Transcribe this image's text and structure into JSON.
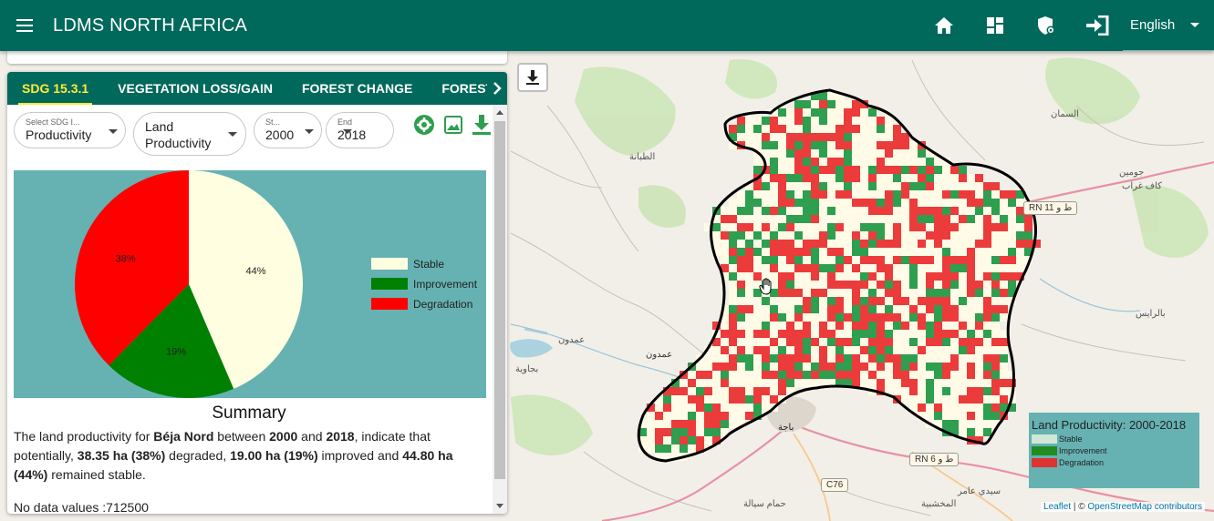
{
  "app": {
    "title": "LDMS NORTH AFRICA",
    "language": "English",
    "icons": [
      "menu-icon",
      "home-icon",
      "dashboard-icon",
      "security-icon",
      "login-icon"
    ]
  },
  "tabs": [
    {
      "label": "SDG 15.3.1",
      "active": true
    },
    {
      "label": "VEGETATION LOSS/GAIN",
      "active": false
    },
    {
      "label": "FOREST CHANGE",
      "active": false
    },
    {
      "label": "FOREST FIRE",
      "active": false
    }
  ],
  "controls": {
    "indicator": {
      "label": "Select SDG I...",
      "value": "Productivity"
    },
    "sub_indicator": {
      "value_line1": "Land",
      "value_line2": "Productivity"
    },
    "start": {
      "label": "St...",
      "value": "2000"
    },
    "end": {
      "label": "End",
      "value": "2018"
    }
  },
  "chart_data": {
    "type": "pie",
    "slices": [
      {
        "label": "Stable",
        "value": 44,
        "display": "44%",
        "color": "#fffee0"
      },
      {
        "label": "Improvement",
        "value": 19,
        "display": "19%",
        "color": "#008000"
      },
      {
        "label": "Degradation",
        "value": 38,
        "display": "38%",
        "color": "#ff0000"
      }
    ],
    "legend_position": "right"
  },
  "summary": {
    "title": "Summary",
    "t1": "The land productivity for ",
    "region": "Béja Nord",
    "t2": " between ",
    "start": "2000",
    "t3": " and ",
    "end": "2018",
    "t4": ", indicate that potentially, ",
    "degraded": "38.35 ha (38%)",
    "t5": " degraded, ",
    "improved": "19.00 ha (19%)",
    "t6": " improved and ",
    "stable": "44.80 ha (44%)",
    "t7": " remained stable.",
    "nodata": "No data values :712500"
  },
  "map": {
    "legend": {
      "title": "Land Productivity: 2000-2018",
      "items": [
        {
          "label": "Stable",
          "color": "#cfe8d5"
        },
        {
          "label": "Improvement",
          "color": "#228b22"
        },
        {
          "label": "Degradation",
          "color": "#dd3333"
        }
      ]
    },
    "attribution_leaflet": "Leaflet",
    "attribution_sep": " | © ",
    "attribution_osm": "OpenStreetMap contributors",
    "place_labels": [
      "عمدون",
      "عمدون",
      "باجة",
      "السمان",
      "جومين",
      "كاف غراب",
      "بالرايس",
      "الطبانة",
      "المخشبية",
      "سيدي عامر",
      "حمام سيالة",
      "بجاوية"
    ],
    "road_shields": [
      "RN 11 ط و",
      "RN 6 ط و",
      "C76"
    ]
  }
}
